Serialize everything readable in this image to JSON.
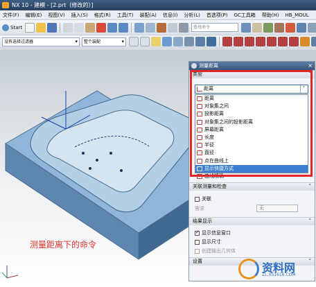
{
  "window": {
    "title": "NX 10 - 建模 - [2.prt（修改的）]"
  },
  "menu": [
    "文件(F)",
    "编辑(E)",
    "视图(V)",
    "插入(S)",
    "格式(R)",
    "工具(T)",
    "装配(A)",
    "信息(I)",
    "分析(L)",
    "首选项(P)",
    "GC工具箱",
    "帮助(H)",
    "HB_MOUL"
  ],
  "toolbar": {
    "start_label": "Start",
    "search_placeholder": "查找命令"
  },
  "toolbar2": {
    "filter_value": "没有选择过滤器",
    "assembly_value": "整个装配"
  },
  "dialog": {
    "title": "测量距离",
    "type_section": "类型",
    "type_selected": "距离",
    "options": [
      "距离",
      "对象集之间",
      "投影距离",
      "对象集之间的投影距离",
      "屏幕距离",
      "长度",
      "半径",
      "直径",
      "点在曲线上",
      "显示快捷方式",
      "曲线精确"
    ],
    "selected_option_index": 9,
    "associativity_section": "关联测量和检查",
    "associative_label": "关联",
    "requirement_label": "需求",
    "requirement_value": "无",
    "results_section": "结果显示",
    "show_info_label": "显示信息窗口",
    "show_dimension_label": "显示尺寸",
    "create_output_label": "创建输出几何体",
    "settings_section": "设置"
  },
  "caption": "测量距离下的命令",
  "watermark": {
    "text": "资料网",
    "url": "ZL.XS1616.COM"
  },
  "colors": {
    "accent": "#e02626",
    "selected": "#3d7fd0",
    "model": "#8fb6d9"
  }
}
